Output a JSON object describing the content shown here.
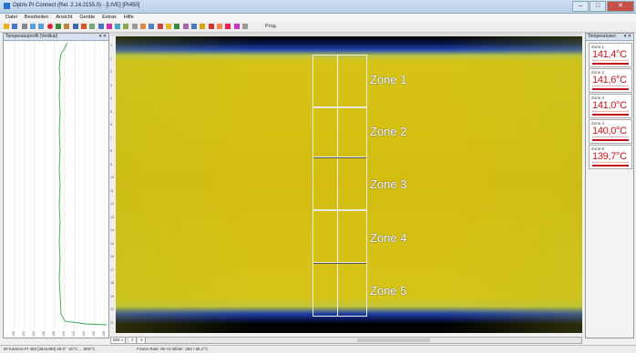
{
  "window": {
    "title": "Optris PI Connect (Rel. 2.14.2155.0) - [LIVE] [PI450]",
    "controls": {
      "minimize": "–",
      "maximize": "□",
      "close": "✕"
    }
  },
  "menu": [
    "Datei",
    "Bearbeiten",
    "Ansicht",
    "Geräte",
    "Extras",
    "Hilfe"
  ],
  "toolbar": {
    "label": "Prog."
  },
  "left_panel": {
    "title": "Temperaturprofil (Vertikal)",
    "pin": "▾ ✕",
    "axis_ticks": [
      "130",
      "132",
      "134",
      "136",
      "138",
      "140",
      "142",
      "144",
      "146",
      "148"
    ]
  },
  "right_panel": {
    "title": "Temperaturen",
    "pin": "▾ ✕",
    "zones": [
      {
        "label": "Zone 1",
        "value": "141,4°C"
      },
      {
        "label": "Zone 2",
        "value": "141,6°C"
      },
      {
        "label": "Zone 3",
        "value": "141,0°C"
      },
      {
        "label": "Zone 4",
        "value": "140,0°C"
      },
      {
        "label": "Zone 5",
        "value": "139,7°C"
      }
    ]
  },
  "main_view": {
    "zones": [
      "Zone 1",
      "Zone 2",
      "Zone 3",
      "Zone 4",
      "Zone 5"
    ],
    "ruler_left": [
      "0",
      "1",
      "2",
      "3",
      "4",
      "5",
      "6",
      "7",
      "8",
      "9",
      "10",
      "11",
      "12",
      "13",
      "14",
      "15",
      "16",
      "17",
      "18",
      "19",
      "20",
      "21"
    ]
  },
  "bottom_tabs": [
    "Bild 1",
    "2",
    "3"
  ],
  "status": {
    "left": "IR-Kamera PI 450 [384x288]  28.0°  -20°C ... 900°C",
    "mid": "Frame Rate: 80 Hz  Bilder: 284 / 86,4°C"
  },
  "colors": {
    "thermal_hot": "#d4bd10",
    "thermal_cold": "#06164d",
    "zone_value": "#c0161b",
    "profile_line": "#3aa655"
  }
}
